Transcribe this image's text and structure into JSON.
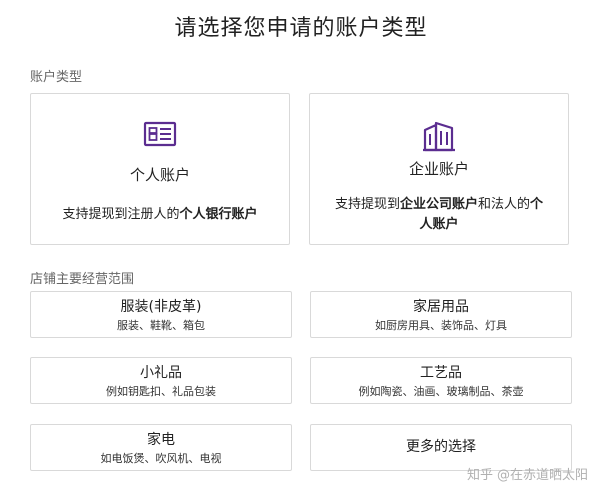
{
  "title": "请选择您申请的账户类型",
  "account_section": {
    "label": "账户类型",
    "cards": [
      {
        "icon": "id-card-icon",
        "name": "个人账户",
        "desc_parts": [
          "支持提现到注册人的",
          "个人银行账户"
        ]
      },
      {
        "icon": "building-icon",
        "name": "企业账户",
        "desc_parts": [
          "支持提现到",
          "企业公司账户",
          "和法人的",
          "个人账户"
        ]
      }
    ]
  },
  "category_section": {
    "label": "店铺主要经营范围",
    "items": [
      {
        "name": "服装(非皮革)",
        "sub": "服装、鞋靴、箱包"
      },
      {
        "name": "家居用品",
        "sub": "如厨房用具、装饰品、灯具"
      },
      {
        "name": "小礼品",
        "sub": "例如钥匙扣、礼品包装"
      },
      {
        "name": "工艺品",
        "sub": "例如陶瓷、油画、玻璃制品、茶壶"
      },
      {
        "name": "家电",
        "sub": "如电饭煲、吹风机、电视"
      },
      {
        "name": "更多的选择",
        "sub": ""
      }
    ]
  },
  "watermark": {
    "brand": "知乎",
    "author": "@在赤道晒太阳"
  },
  "colors": {
    "accent": "#5b2d90",
    "border": "#d9d9d9"
  }
}
